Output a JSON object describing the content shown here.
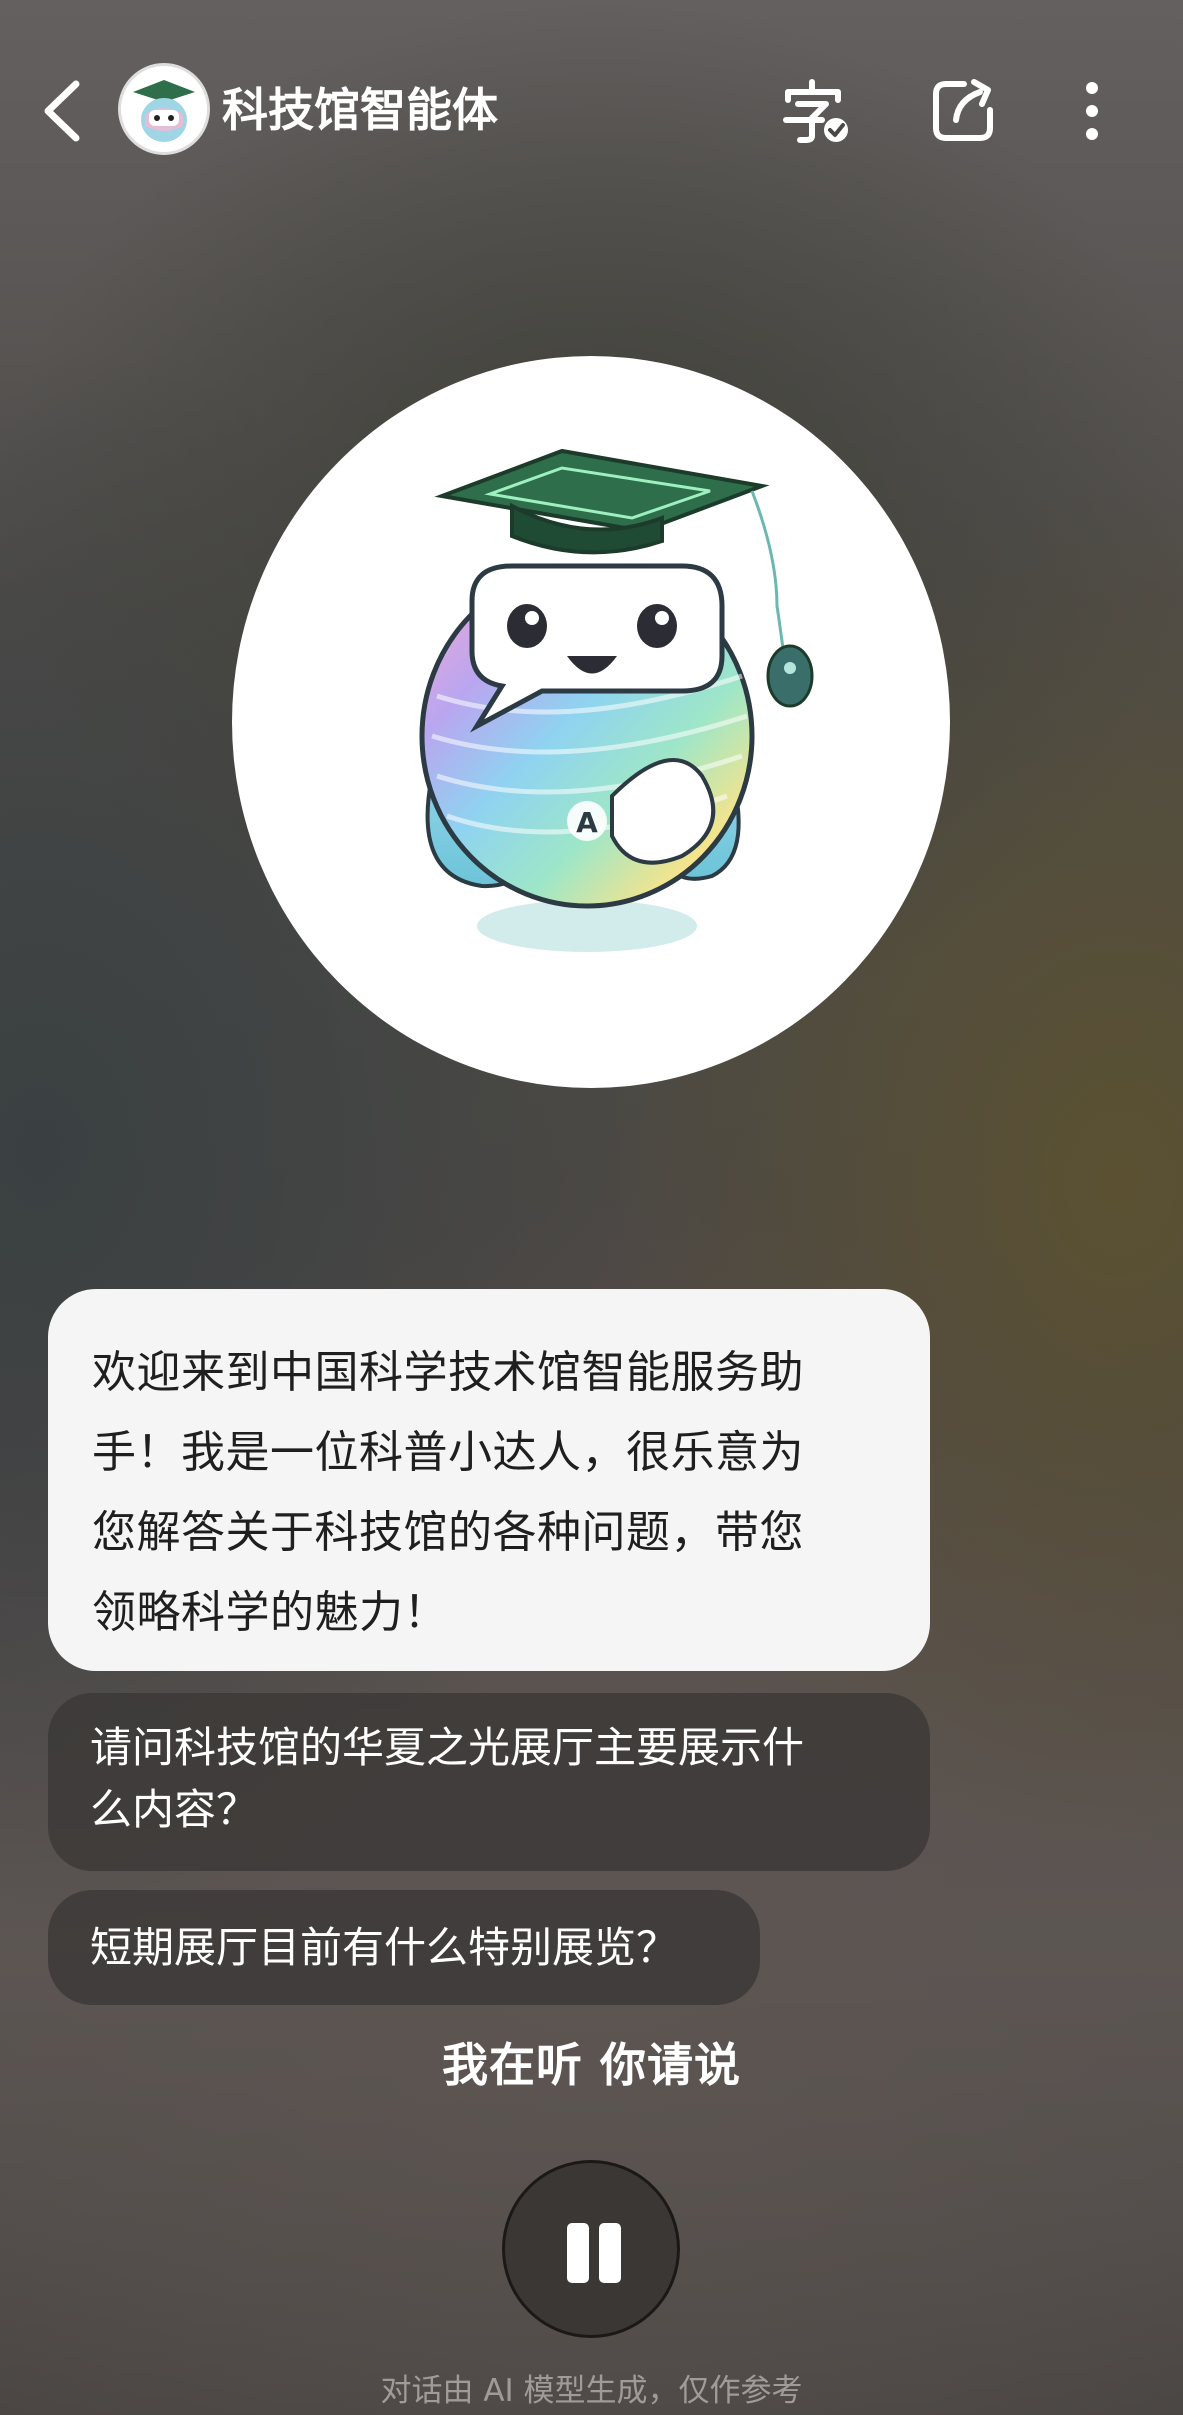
{
  "header": {
    "title": "科技馆智能体",
    "back_icon": "chevron-left-icon",
    "font_icon": "font-size-check-icon",
    "share_icon": "share-export-icon",
    "more_icon": "more-vertical-icon"
  },
  "avatar": {
    "description_icon": "mascot-graduation-cap-icon",
    "badge_letter": "A"
  },
  "chat": {
    "ai_lines": [
      "欢迎来到中国科学技术馆智能服务助",
      "手！我是一位科普小达人，很乐意为",
      "您解答关于科技馆的各种问题，带您",
      "领略科学的魅力！"
    ],
    "suggestions": [
      {
        "lines": [
          "请问科技馆的华夏之光展厅主要展示什",
          "么内容？"
        ]
      },
      {
        "lines": [
          "短期展厅目前有什么特别展览？"
        ]
      }
    ]
  },
  "status": {
    "listening_text": "我在听 你请说"
  },
  "controls": {
    "pause_icon": "pause-icon"
  },
  "footer": {
    "disclaimer": "对话由 AI 模型生成，仅作参考"
  },
  "colors": {
    "bubble_ai_bg": "#f5f5f5",
    "suggestion_bg": "#3a3736",
    "cap_green": "#2e6e4a",
    "text_primary": "#ffffff"
  }
}
